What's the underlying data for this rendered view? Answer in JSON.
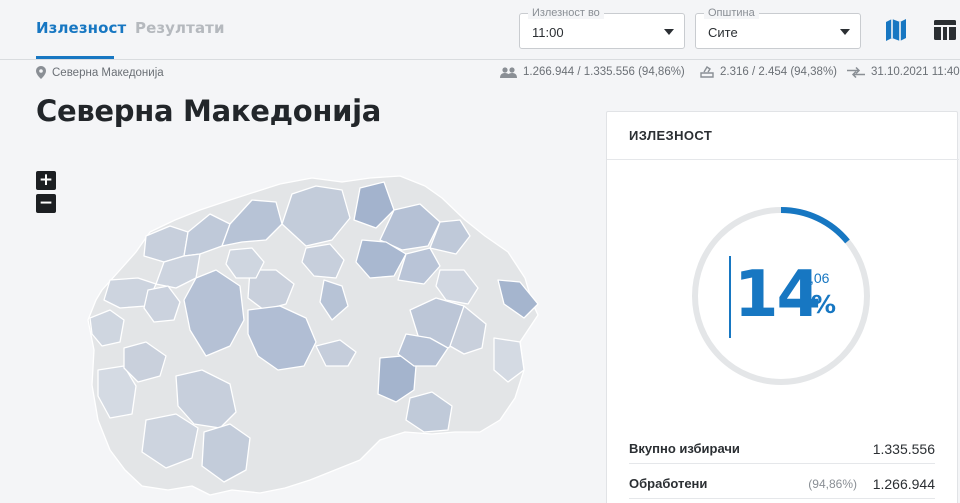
{
  "tabs": {
    "turnout": "Излезност",
    "results": "Резултати"
  },
  "filters": {
    "time": {
      "label": "Излезност во",
      "value": "11:00"
    },
    "municipality": {
      "label": "Општина",
      "value": "Сите"
    }
  },
  "header_icons": [
    "map-icon",
    "table-icon"
  ],
  "info": {
    "location": "Северна Македонија",
    "voters": "1.266.944 / 1.335.556 (94,86%)",
    "polling_stations": "2.316 / 2.454 (94,38%)",
    "updated": "31.10.2021 11:40"
  },
  "page_title": "Северна Македонија",
  "zoom": {
    "in": "+",
    "out": "−"
  },
  "card": {
    "title": "ИЗЛЕЗНОСТ",
    "turnout_int": "14",
    "turnout_dec": ",06",
    "turnout_unit": "%",
    "turnout_value": 14.06,
    "rows": [
      {
        "label": "Вкупно избирачи",
        "percent": "",
        "value": "1.335.556"
      },
      {
        "label": "Обработени",
        "percent": "(94,86%)",
        "value": "1.266.944"
      }
    ]
  },
  "colors": {
    "accent": "#1777c2",
    "map_low": "#e2e4e6",
    "map_high": "#a3b3cd"
  }
}
